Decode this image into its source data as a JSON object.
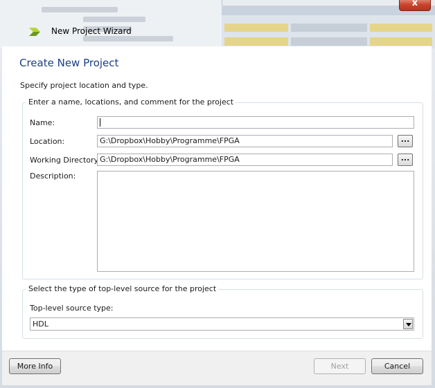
{
  "window": {
    "title": "New Project Wizard",
    "close_glyph": "x"
  },
  "header": {
    "heading": "Create New Project",
    "subtitle": "Specify project location and type."
  },
  "project_group": {
    "legend": "Enter a name, locations, and comment for the project",
    "name_label": "Name:",
    "name_value": "",
    "location_label": "Location:",
    "location_value": "G:\\Dropbox\\Hobby\\Programme\\FPGA",
    "workdir_label": "Working Directory:",
    "workdir_value": "G:\\Dropbox\\Hobby\\Programme\\FPGA",
    "description_label": "Description:",
    "description_value": "",
    "browse_label": "..."
  },
  "source_group": {
    "legend": "Select the type of top-level source for the project",
    "type_label": "Top-level source type:",
    "type_value": "HDL"
  },
  "footer": {
    "more_info": "More Info",
    "next": "Next",
    "cancel": "Cancel"
  },
  "colors": {
    "heading": "#1c3e86",
    "close": "#c9432b"
  }
}
